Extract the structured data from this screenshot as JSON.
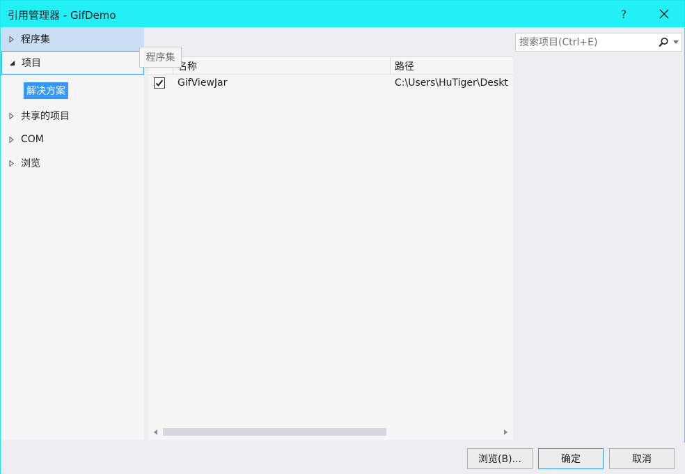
{
  "window": {
    "title": "引用管理器 - GifDemo",
    "help_glyph": "?"
  },
  "nav": {
    "items": [
      {
        "label": "程序集",
        "expanded": false,
        "state": "selected"
      },
      {
        "label": "项目",
        "expanded": true,
        "state": "focused"
      },
      {
        "label": "共享的项目",
        "expanded": false,
        "state": "normal"
      },
      {
        "label": "COM",
        "expanded": false,
        "state": "normal"
      },
      {
        "label": "浏览",
        "expanded": false,
        "state": "normal"
      }
    ],
    "sub_item": {
      "label": "解决方案"
    },
    "tooltip": "程序集"
  },
  "list": {
    "columns": [
      "名称",
      "路径"
    ],
    "rows": [
      {
        "checked": true,
        "name": "GifViewJar",
        "path": "C:\\Users\\HuTiger\\Deskt"
      }
    ]
  },
  "search": {
    "placeholder": "搜索项目(Ctrl+E)",
    "value": ""
  },
  "footer": {
    "browse_label": "浏览(B)...",
    "ok_label": "确定",
    "cancel_label": "取消"
  },
  "colors": {
    "titlebar": "#21f0f7",
    "accent": "#3399ff",
    "selected_bg": "#c9def5"
  }
}
